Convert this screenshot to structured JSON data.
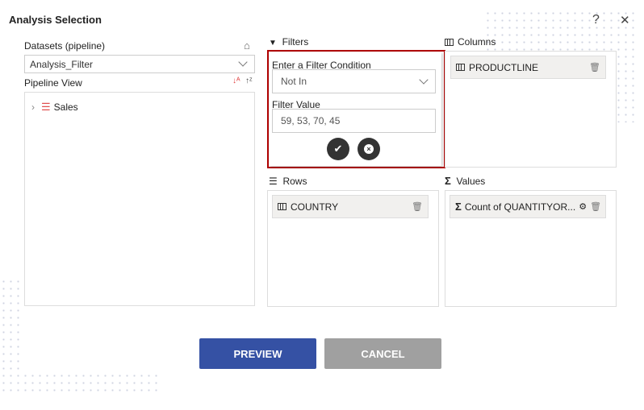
{
  "dialog": {
    "title": "Analysis Selection",
    "help": "?",
    "close": "✕"
  },
  "datasets": {
    "label": "Datasets (pipeline)",
    "selected": "Analysis_Filter"
  },
  "pipeline": {
    "label": "Pipeline View",
    "tree": [
      {
        "label": "Sales"
      }
    ]
  },
  "filters": {
    "label": "Filters",
    "condition_label": "Enter a Filter Condition",
    "condition_value": "Not In",
    "value_label": "Filter Value",
    "value": "59, 53, 70, 45"
  },
  "columns": {
    "label": "Columns",
    "items": [
      {
        "label": "PRODUCTLINE"
      }
    ]
  },
  "rows": {
    "label": "Rows",
    "items": [
      {
        "label": "COUNTRY"
      }
    ]
  },
  "values": {
    "label": "Values",
    "items": [
      {
        "label": "Count of QUANTITYOR..."
      }
    ]
  },
  "buttons": {
    "preview": "PREVIEW",
    "cancel": "CANCEL"
  },
  "colors": {
    "primary": "#3551a4",
    "disabled": "#a0a0a0",
    "highlight": "#b00000"
  }
}
